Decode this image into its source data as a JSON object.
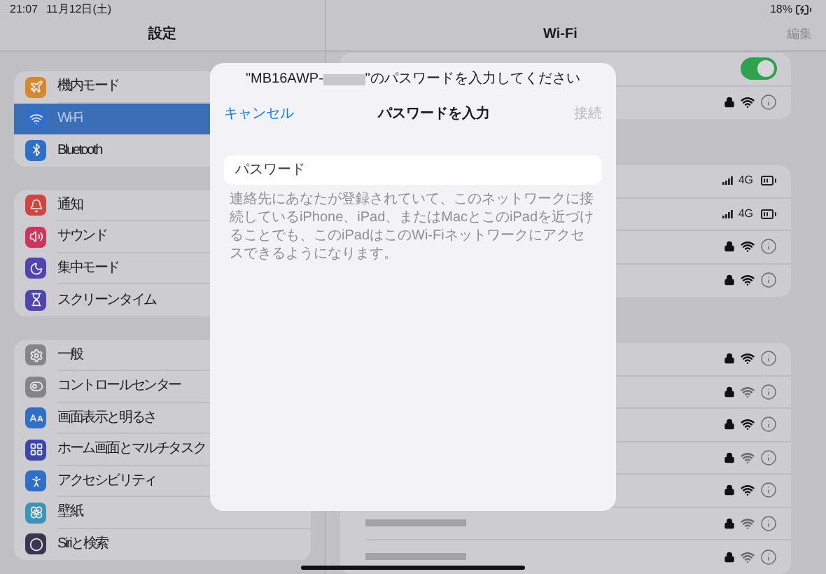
{
  "status_bar": {
    "time": "21:07",
    "date": "11月12日(土)",
    "battery": "18%"
  },
  "sidebar": {
    "title": "設定",
    "groups": [
      {
        "items": [
          {
            "label": "機内モード",
            "color": "#d48a2c",
            "selected": false
          },
          {
            "label": "Wi-Fi",
            "color": "#2f6fc8",
            "selected": true
          },
          {
            "label": "Bluetooth",
            "color": "#2f6fc8",
            "selected": false
          }
        ]
      },
      {
        "items": [
          {
            "label": "通知",
            "color": "#d4443f",
            "selected": false
          },
          {
            "label": "サウンド",
            "color": "#d1345a",
            "selected": false
          },
          {
            "label": "集中モード",
            "color": "#4f45ad",
            "selected": false
          },
          {
            "label": "スクリーンタイム",
            "color": "#4f45ad",
            "selected": false
          }
        ]
      },
      {
        "items": [
          {
            "label": "一般",
            "color": "#858589",
            "selected": false
          },
          {
            "label": "コントロールセンター",
            "color": "#858589",
            "selected": false
          },
          {
            "label": "画面表示と明るさ",
            "color": "#2f6fc8",
            "selected": false
          },
          {
            "label": "ホーム画面とマルチタスク",
            "color": "#3a45b0",
            "selected": false
          },
          {
            "label": "アクセシビリティ",
            "color": "#2f6fc8",
            "selected": false
          },
          {
            "label": "壁紙",
            "color": "#3a96b8",
            "selected": false
          },
          {
            "label": "Siriと検索",
            "color": "#3a3550",
            "selected": false
          }
        ]
      }
    ]
  },
  "wifi_pane": {
    "title": "Wi-Fi",
    "edit_button": "編集",
    "groups": [
      {
        "rows": [
          {
            "kind": "toggle",
            "on": true
          },
          {
            "kind": "network",
            "weak": false
          }
        ]
      },
      {
        "rows": [
          {
            "kind": "hotspot",
            "network_type": "4G"
          },
          {
            "kind": "hotspot",
            "network_type": "4G"
          },
          {
            "kind": "network",
            "weak": false
          },
          {
            "kind": "network",
            "weak": false
          }
        ]
      },
      {
        "rows": [
          {
            "kind": "network",
            "weak": false
          },
          {
            "kind": "network",
            "weak": true
          },
          {
            "kind": "network",
            "weak": false
          },
          {
            "kind": "network",
            "weak": true
          },
          {
            "kind": "network",
            "weak": false
          },
          {
            "kind": "network",
            "weak": true
          },
          {
            "kind": "network",
            "weak": true
          }
        ]
      }
    ]
  },
  "dialog": {
    "prompt_start": "\"MB16AWP-",
    "prompt_end": "\"のパスワードを入力してください",
    "cancel": "キャンセル",
    "title": "パスワードを入力",
    "connect": {
      "label": "接続",
      "disabled": true
    },
    "password_field": {
      "placeholder": "パスワード"
    },
    "hint": "連絡先にあなたが登録されていて、このネットワークに接続しているiPhone、iPad、またはMacとこのiPadを近づけることでも、このiPadはこのWi-Fiネットワークにアクセスできるようになります。"
  }
}
